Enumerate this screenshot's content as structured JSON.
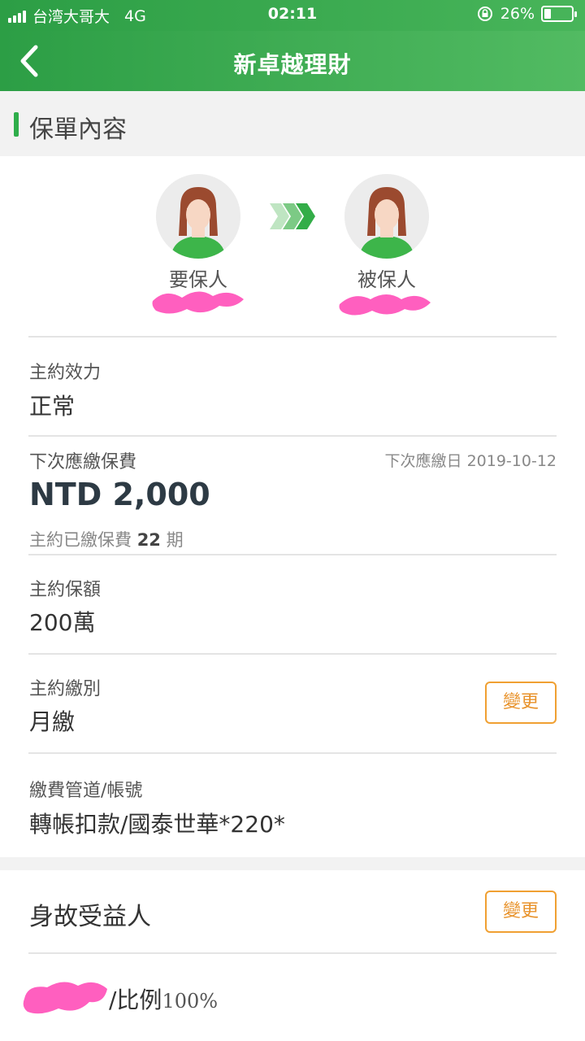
{
  "status_bar": {
    "carrier": "台湾大哥大",
    "network": "4G",
    "time": "02:11",
    "battery": "26%",
    "battery_level": 0.26
  },
  "nav": {
    "title": "新卓越理財",
    "back_icon": "chevron-left-icon"
  },
  "section": {
    "title": "保單內容"
  },
  "parties": {
    "applicant_label": "要保人",
    "insured_label": "被保人",
    "arrow_icon": "triple-chevron-right-icon"
  },
  "policy": {
    "status_label": "主約效力",
    "status_value": "正常",
    "next_premium_label": "下次應繳保費",
    "next_due_label": "下次應繳日",
    "next_due_date": "2019-10-12",
    "next_premium_amount": "NTD 2,000",
    "paid_prefix": "主約已繳保費",
    "paid_count": "22",
    "paid_suffix": "期",
    "sum_insured_label": "主約保額",
    "sum_insured_value": "200萬",
    "payment_mode_label": "主約繳別",
    "payment_mode_value": "月繳",
    "change_label": "變更",
    "channel_label": "繳費管道/帳號",
    "channel_value": "轉帳扣款/國泰世華*220*"
  },
  "beneficiary": {
    "title": "身故受益人",
    "change_label": "變更",
    "ratio_label": "/比例",
    "ratio_value": "100%"
  },
  "colors": {
    "brand_green": "#2c9e45",
    "accent_orange": "#f0a032",
    "redaction_pink": "#ff5fbf"
  }
}
